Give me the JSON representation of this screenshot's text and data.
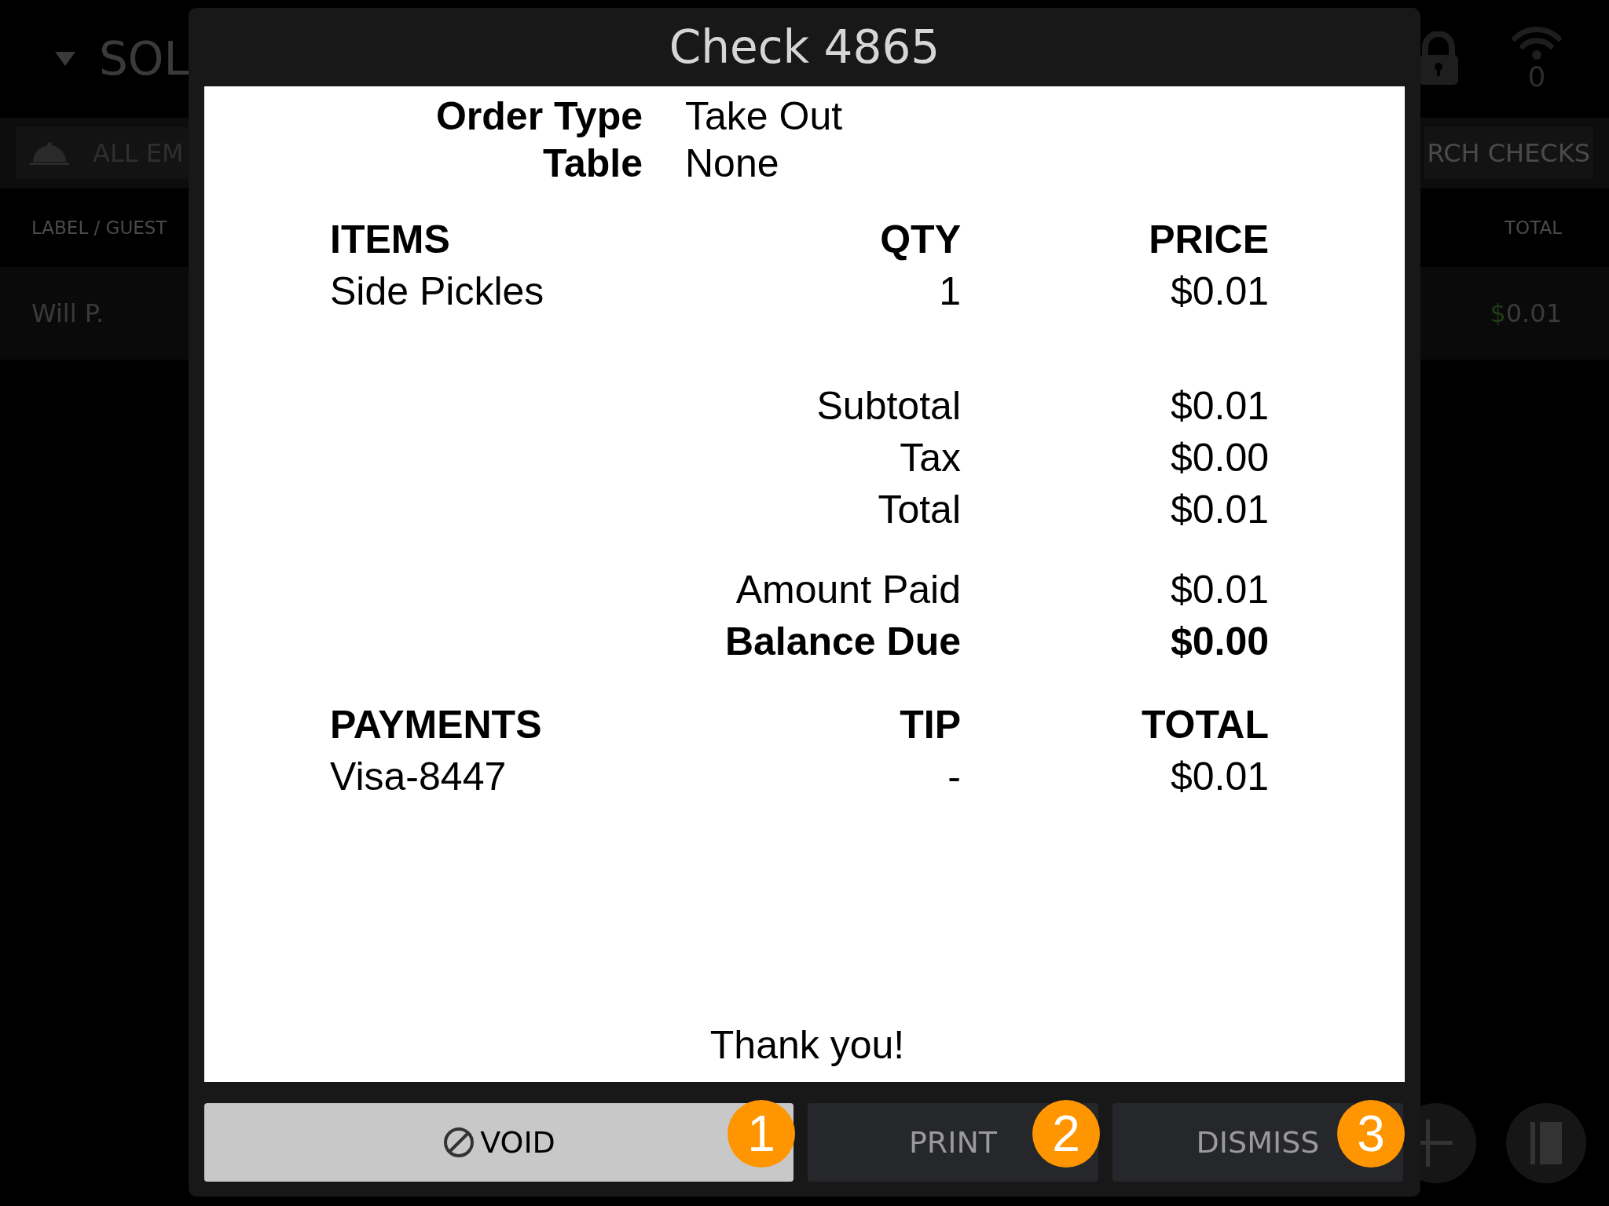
{
  "background": {
    "brand": "SOL",
    "filter_button": "ALL EM",
    "search_button": "RCH CHECKS",
    "wifi_count": "0",
    "columns": [
      "LABEL / GUEST",
      "TOTAL"
    ],
    "rows": [
      {
        "guest": "Will P.",
        "currency": "$",
        "total": "0.01"
      }
    ]
  },
  "dialog": {
    "title": "Check 4865",
    "receipt": {
      "meta": [
        {
          "label": "Order Type",
          "value": "Take Out"
        },
        {
          "label": "Table",
          "value": "None"
        }
      ],
      "items_header": {
        "items": "ITEMS",
        "qty": "QTY",
        "price": "PRICE"
      },
      "items": [
        {
          "name": "Side Pickles",
          "qty": "1",
          "price": "$0.01"
        }
      ],
      "totals": [
        {
          "label": "Subtotal",
          "value": "$0.01",
          "bold": false
        },
        {
          "label": "Tax",
          "value": "$0.00",
          "bold": false
        },
        {
          "label": "Total",
          "value": "$0.01",
          "bold": false
        }
      ],
      "balance": [
        {
          "label": "Amount Paid",
          "value": "$0.01",
          "bold": false
        },
        {
          "label": "Balance Due",
          "value": "$0.00",
          "bold": true
        }
      ],
      "payments_header": {
        "payments": "PAYMENTS",
        "tip": "TIP",
        "total": "TOTAL"
      },
      "payments": [
        {
          "method": "Visa-8447",
          "tip": "-",
          "total": "$0.01"
        }
      ],
      "footer": "Thank you!"
    },
    "buttons": [
      {
        "kind": "void",
        "label": "VOID",
        "badge": "1"
      },
      {
        "kind": "plain",
        "label": "PRINT",
        "badge": "2"
      },
      {
        "kind": "plain",
        "label": "DISMISS",
        "badge": "3"
      }
    ]
  }
}
